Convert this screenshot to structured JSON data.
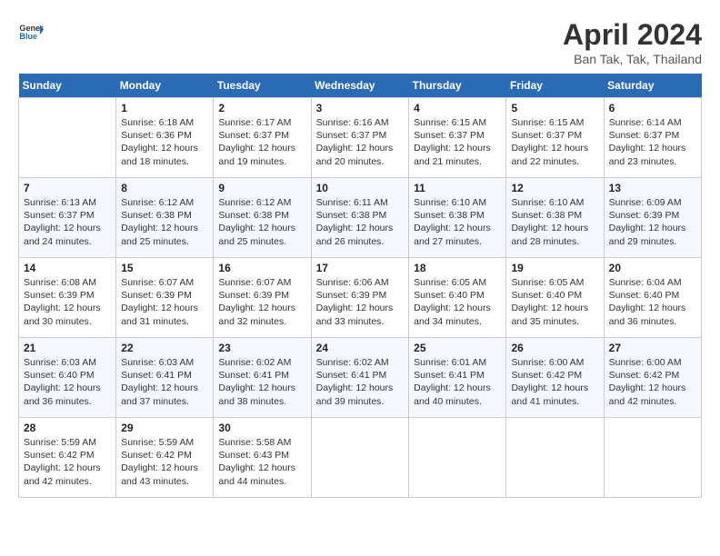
{
  "header": {
    "logo_line1": "General",
    "logo_line2": "Blue",
    "title": "April 2024",
    "subtitle": "Ban Tak, Tak, Thailand"
  },
  "weekdays": [
    "Sunday",
    "Monday",
    "Tuesday",
    "Wednesday",
    "Thursday",
    "Friday",
    "Saturday"
  ],
  "weeks": [
    [
      {
        "num": "",
        "empty": true
      },
      {
        "num": "1",
        "sunrise": "6:18 AM",
        "sunset": "6:36 PM",
        "daylight": "12 hours and 18 minutes."
      },
      {
        "num": "2",
        "sunrise": "6:17 AM",
        "sunset": "6:37 PM",
        "daylight": "12 hours and 19 minutes."
      },
      {
        "num": "3",
        "sunrise": "6:16 AM",
        "sunset": "6:37 PM",
        "daylight": "12 hours and 20 minutes."
      },
      {
        "num": "4",
        "sunrise": "6:15 AM",
        "sunset": "6:37 PM",
        "daylight": "12 hours and 21 minutes."
      },
      {
        "num": "5",
        "sunrise": "6:15 AM",
        "sunset": "6:37 PM",
        "daylight": "12 hours and 22 minutes."
      },
      {
        "num": "6",
        "sunrise": "6:14 AM",
        "sunset": "6:37 PM",
        "daylight": "12 hours and 23 minutes."
      }
    ],
    [
      {
        "num": "7",
        "sunrise": "6:13 AM",
        "sunset": "6:37 PM",
        "daylight": "12 hours and 24 minutes."
      },
      {
        "num": "8",
        "sunrise": "6:12 AM",
        "sunset": "6:38 PM",
        "daylight": "12 hours and 25 minutes."
      },
      {
        "num": "9",
        "sunrise": "6:12 AM",
        "sunset": "6:38 PM",
        "daylight": "12 hours and 25 minutes."
      },
      {
        "num": "10",
        "sunrise": "6:11 AM",
        "sunset": "6:38 PM",
        "daylight": "12 hours and 26 minutes."
      },
      {
        "num": "11",
        "sunrise": "6:10 AM",
        "sunset": "6:38 PM",
        "daylight": "12 hours and 27 minutes."
      },
      {
        "num": "12",
        "sunrise": "6:10 AM",
        "sunset": "6:38 PM",
        "daylight": "12 hours and 28 minutes."
      },
      {
        "num": "13",
        "sunrise": "6:09 AM",
        "sunset": "6:39 PM",
        "daylight": "12 hours and 29 minutes."
      }
    ],
    [
      {
        "num": "14",
        "sunrise": "6:08 AM",
        "sunset": "6:39 PM",
        "daylight": "12 hours and 30 minutes."
      },
      {
        "num": "15",
        "sunrise": "6:07 AM",
        "sunset": "6:39 PM",
        "daylight": "12 hours and 31 minutes."
      },
      {
        "num": "16",
        "sunrise": "6:07 AM",
        "sunset": "6:39 PM",
        "daylight": "12 hours and 32 minutes."
      },
      {
        "num": "17",
        "sunrise": "6:06 AM",
        "sunset": "6:39 PM",
        "daylight": "12 hours and 33 minutes."
      },
      {
        "num": "18",
        "sunrise": "6:05 AM",
        "sunset": "6:40 PM",
        "daylight": "12 hours and 34 minutes."
      },
      {
        "num": "19",
        "sunrise": "6:05 AM",
        "sunset": "6:40 PM",
        "daylight": "12 hours and 35 minutes."
      },
      {
        "num": "20",
        "sunrise": "6:04 AM",
        "sunset": "6:40 PM",
        "daylight": "12 hours and 36 minutes."
      }
    ],
    [
      {
        "num": "21",
        "sunrise": "6:03 AM",
        "sunset": "6:40 PM",
        "daylight": "12 hours and 36 minutes."
      },
      {
        "num": "22",
        "sunrise": "6:03 AM",
        "sunset": "6:41 PM",
        "daylight": "12 hours and 37 minutes."
      },
      {
        "num": "23",
        "sunrise": "6:02 AM",
        "sunset": "6:41 PM",
        "daylight": "12 hours and 38 minutes."
      },
      {
        "num": "24",
        "sunrise": "6:02 AM",
        "sunset": "6:41 PM",
        "daylight": "12 hours and 39 minutes."
      },
      {
        "num": "25",
        "sunrise": "6:01 AM",
        "sunset": "6:41 PM",
        "daylight": "12 hours and 40 minutes."
      },
      {
        "num": "26",
        "sunrise": "6:00 AM",
        "sunset": "6:42 PM",
        "daylight": "12 hours and 41 minutes."
      },
      {
        "num": "27",
        "sunrise": "6:00 AM",
        "sunset": "6:42 PM",
        "daylight": "12 hours and 42 minutes."
      }
    ],
    [
      {
        "num": "28",
        "sunrise": "5:59 AM",
        "sunset": "6:42 PM",
        "daylight": "12 hours and 42 minutes."
      },
      {
        "num": "29",
        "sunrise": "5:59 AM",
        "sunset": "6:42 PM",
        "daylight": "12 hours and 43 minutes."
      },
      {
        "num": "30",
        "sunrise": "5:58 AM",
        "sunset": "6:43 PM",
        "daylight": "12 hours and 44 minutes."
      },
      {
        "num": "",
        "empty": true
      },
      {
        "num": "",
        "empty": true
      },
      {
        "num": "",
        "empty": true
      },
      {
        "num": "",
        "empty": true
      }
    ]
  ]
}
